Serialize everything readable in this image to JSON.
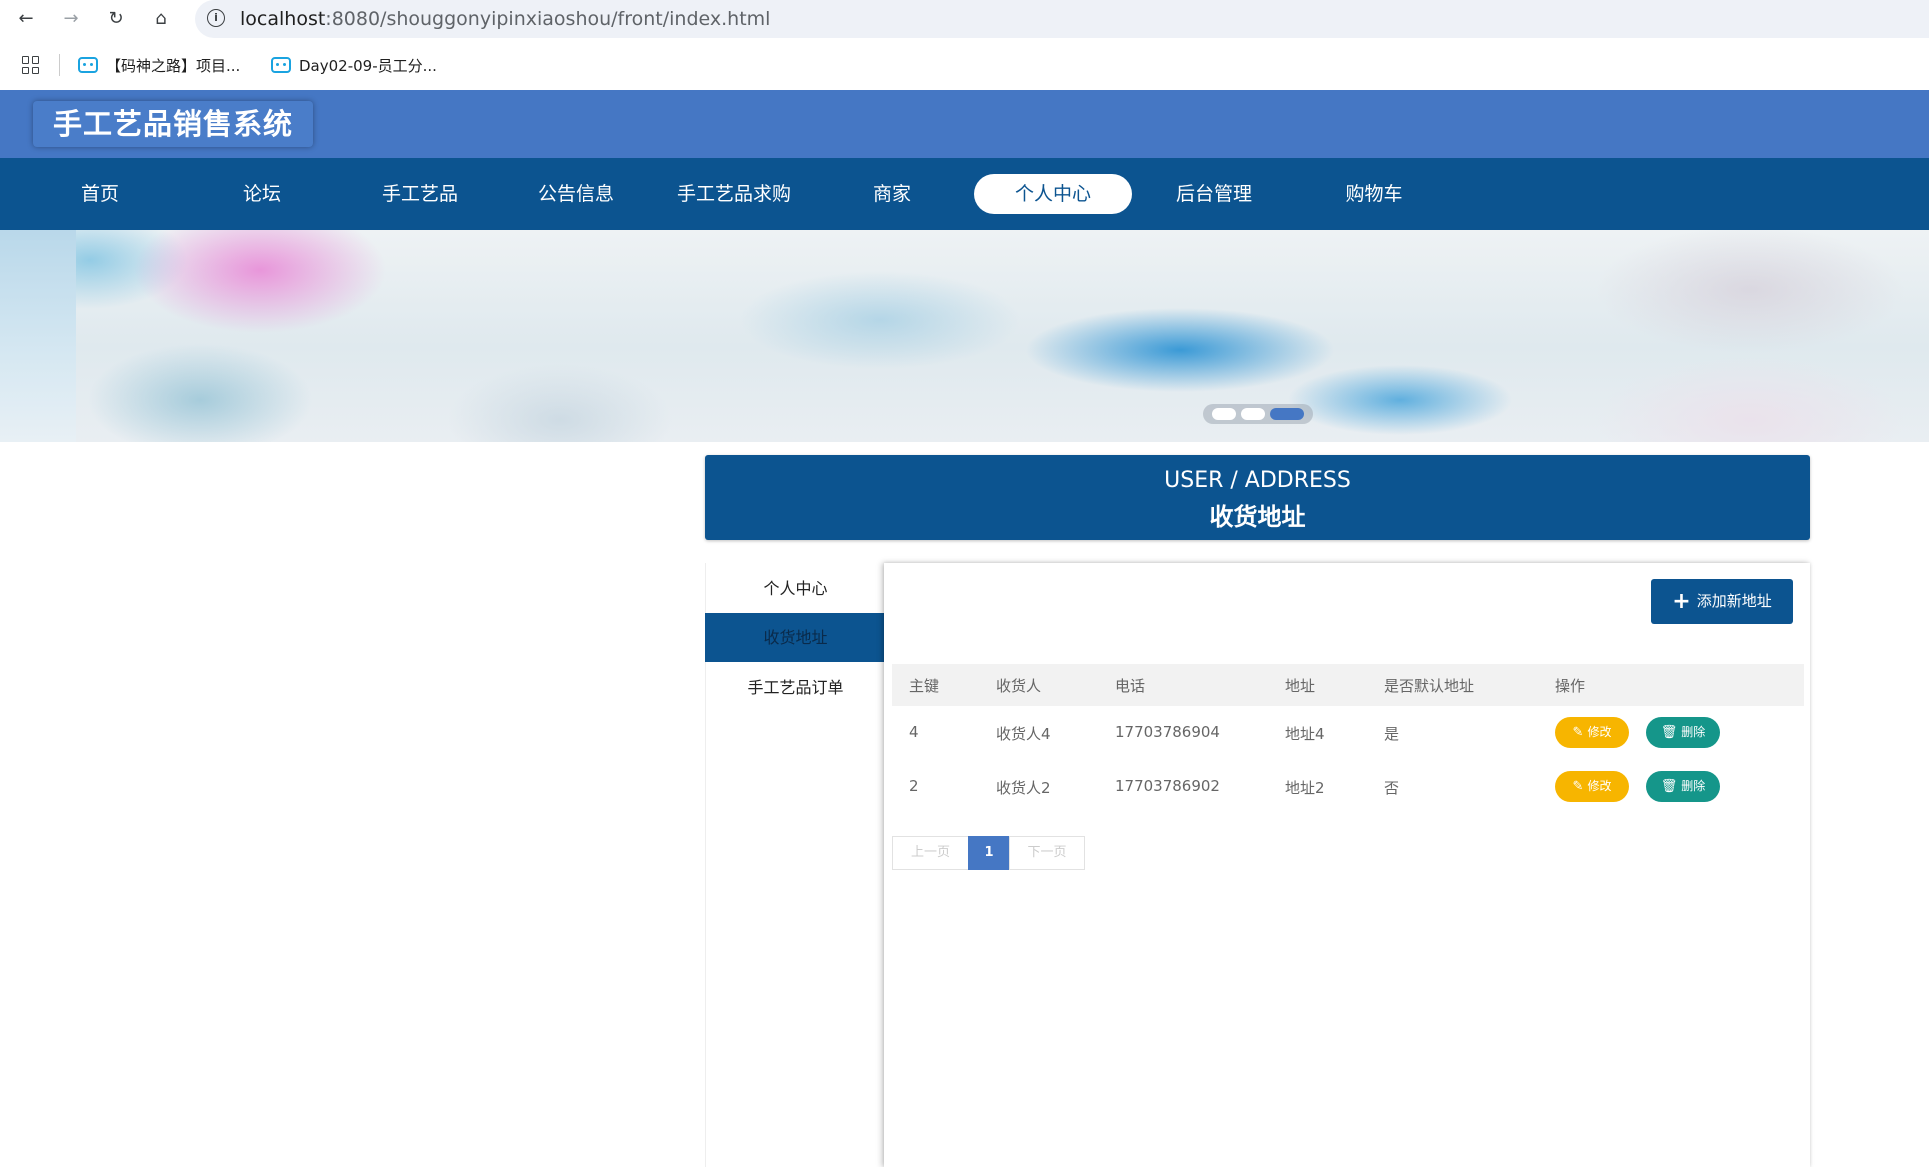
{
  "browser": {
    "url_host": "localhost",
    "url_rest": ":8080/shouggonyipinxiaoshou/front/index.html",
    "bookmarks": [
      "【码神之路】项目...",
      "Day02-09-员工分..."
    ]
  },
  "site": {
    "title": "手工艺品销售系统",
    "nav": [
      "首页",
      "论坛",
      "手工艺品",
      "公告信息",
      "手工艺品求购",
      "商家",
      "个人中心",
      "后台管理",
      "购物车"
    ],
    "active_nav": "个人中心"
  },
  "page": {
    "title_en": "USER / ADDRESS",
    "title_zh": "收货地址"
  },
  "sidebar": {
    "items": [
      "个人中心",
      "收货地址",
      "手工艺品订单"
    ],
    "active": "收货地址"
  },
  "toolbar": {
    "add_label": "添加新地址"
  },
  "table": {
    "columns": [
      "主键",
      "收货人",
      "电话",
      "地址",
      "是否默认地址",
      "操作"
    ],
    "rows": [
      {
        "id": "4",
        "name": "收货人4",
        "phone": "17703786904",
        "address": "地址4",
        "default": "是"
      },
      {
        "id": "2",
        "name": "收货人2",
        "phone": "17703786902",
        "address": "地址2",
        "default": "否"
      }
    ],
    "edit_label": "修改",
    "delete_label": "删除"
  },
  "pagination": {
    "prev": "上一页",
    "current": "1",
    "next": "下一页"
  },
  "colors": {
    "header": "#4577c4",
    "nav": "#0c5490",
    "edit": "#f7b500",
    "delete": "#15968a"
  }
}
